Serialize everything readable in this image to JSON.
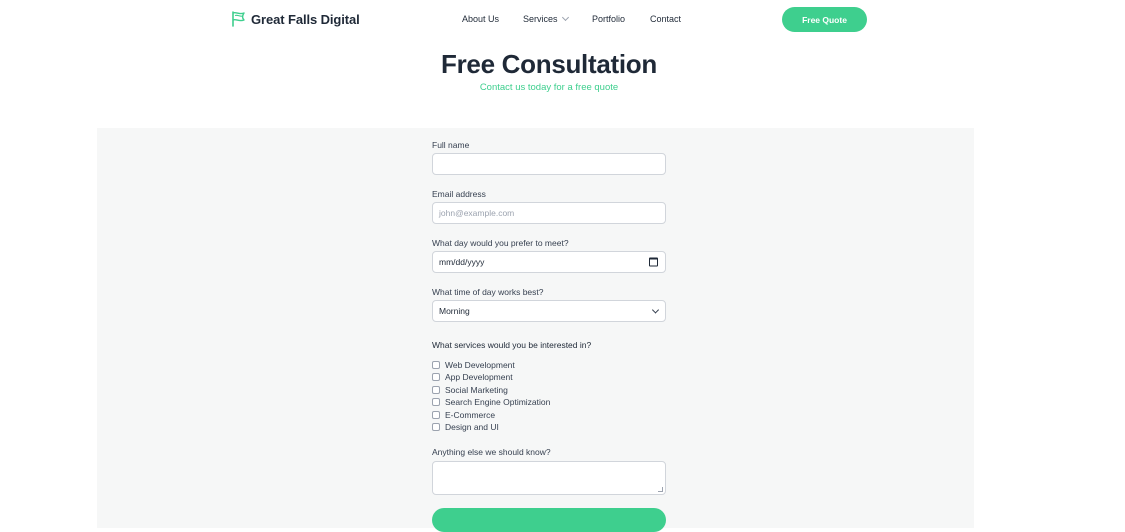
{
  "brand": {
    "name": "Great Falls Digital",
    "icon": "flag-icon",
    "color": "#3ecf8e"
  },
  "nav": {
    "links": [
      "About Us",
      "Services",
      "Portfolio",
      "Contact"
    ],
    "cta_label": "Free Quote"
  },
  "hero": {
    "title": "Free Consultation",
    "subtitle": "Contact us today for a free quote"
  },
  "form": {
    "full_name": {
      "label": "Full name",
      "value": "",
      "placeholder": ""
    },
    "email": {
      "label": "Email address",
      "placeholder": "john@example.com"
    },
    "meet_day": {
      "label": "What day would you prefer to meet?",
      "value": "mm/dd/yyyy",
      "icon": "calendar-icon"
    },
    "meet_time": {
      "label": "What time of day works best?",
      "selected": "Morning"
    },
    "services": {
      "label": "What services would you be interested in?",
      "options": [
        "Web Development",
        "App Development",
        "Social Marketing",
        "Search Engine Optimization",
        "E-Commerce",
        "Design and UI"
      ]
    },
    "notes": {
      "label": "Anything else we should know?",
      "value": ""
    }
  },
  "colors": {
    "accent": "#3ecf8e",
    "panel": "#f6f7f7",
    "text": "#1f2937"
  }
}
